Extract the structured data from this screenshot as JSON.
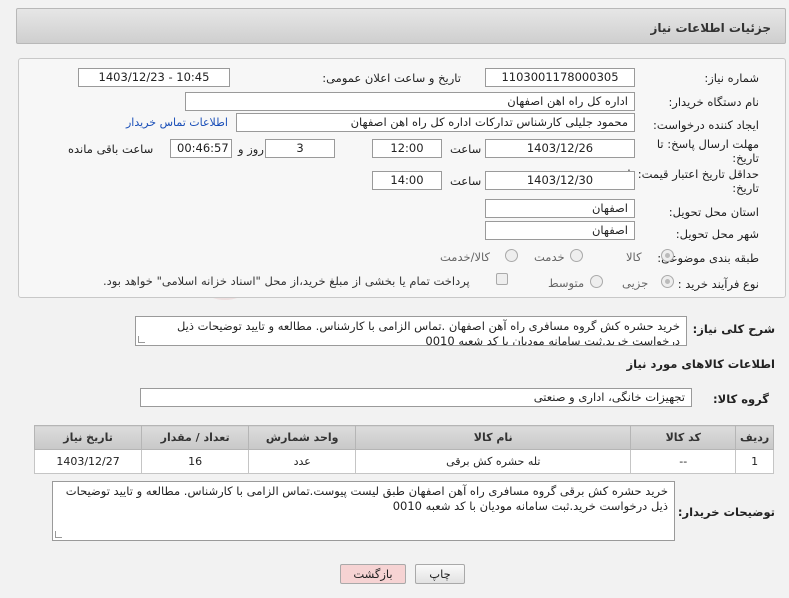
{
  "header": {
    "title": "جزئیات اطلاعات نیاز"
  },
  "form": {
    "need_number_label": "شماره نیاز:",
    "need_number": "1103001178000305",
    "announce_label": "تاریخ و ساعت اعلان عمومی:",
    "announce_value": "1403/12/23 - 10:45",
    "buyer_org_label": "نام دستگاه خریدار:",
    "buyer_org": "اداره کل راه اهن اصفهان",
    "creator_label": "ایجاد کننده درخواست:",
    "creator": "محمود جلیلی کارشناس تدارکات اداره کل راه اهن اصفهان",
    "contact_link": "اطلاعات تماس خریدار",
    "deadline_label_1": "مهلت ارسال پاسخ: تا",
    "deadline_label_2": "تاریخ:",
    "deadline_date": "1403/12/26",
    "time_word": "ساعت",
    "deadline_time": "12:00",
    "days_value": "3",
    "days_word": "روز و",
    "remaining_time": "00:46:57",
    "remaining_word": "ساعت باقی مانده",
    "validity_label_1": "حداقل تاریخ اعتبار قیمت: تا",
    "validity_label_2": "تاریخ:",
    "validity_date": "1403/12/30",
    "validity_time": "14:00",
    "province_label": "استان محل تحویل:",
    "province": "اصفهان",
    "city_label": "شهر محل تحویل:",
    "city": "اصفهان",
    "category_label": "طبقه بندی موضوعی:",
    "category_options": [
      "کالا",
      "خدمت",
      "کالا/خدمت"
    ],
    "process_label": "نوع فرآیند خرید :",
    "process_options": [
      "جزیی",
      "متوسط"
    ],
    "payment_note": "پرداخت تمام یا بخشی از مبلغ خرید،از محل \"اسناد خزانه اسلامی\" خواهد بود."
  },
  "summary": {
    "label": "شرح کلی نیاز:",
    "text": "خرید حشره کش  گروه مسافری راه آهن اصفهان .تماس الزامی با کارشناس. مطالعه و تایید توضیحات ذیل درخواست خرید.ثبت سامانه مودیان با کد شعبه 0010"
  },
  "goods": {
    "section_title": "اطلاعات کالاهای مورد نیاز",
    "group_label": "گروه کالا:",
    "group_value": "تجهیزات خانگی، اداری و صنعتی",
    "columns": [
      "ردیف",
      "کد کالا",
      "نام کالا",
      "واحد شمارش",
      "تعداد / مقدار",
      "تاریخ نیاز"
    ],
    "rows": [
      [
        "1",
        "--",
        "تله حشره کش برقی",
        "عدد",
        "16",
        "1403/12/27"
      ]
    ]
  },
  "buyer_notes": {
    "label": "توضیحات خریدار:",
    "text": "خرید حشره کش برقی گروه مسافری راه آهن اصفهان طبق لیست پیوست.تماس الزامی با کارشناس. مطالعه و تایید توضیحات ذیل درخواست خرید.ثبت سامانه مودیان با کد شعبه 0010"
  },
  "buttons": {
    "print": "چاپ",
    "back": "بازگشت"
  },
  "colors": {
    "back_button": "#f6d3d3",
    "link": "#1a4fb8"
  }
}
